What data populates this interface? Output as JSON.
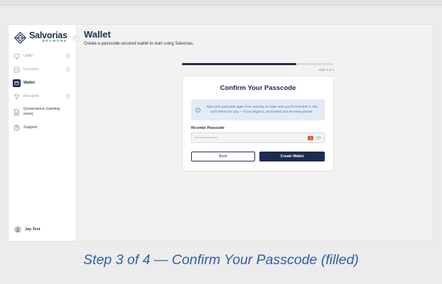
{
  "app": {
    "name": "Salvorias",
    "subtitle": "NETWORK"
  },
  "sidebar": {
    "items": [
      {
        "label": "Utility",
        "icon": "utility-icon",
        "locked": true
      },
      {
        "label": "Licenses",
        "icon": "license-icon",
        "locked": true
      },
      {
        "label": "Wallet",
        "icon": "wallet-icon",
        "active": true
      },
      {
        "label": "Rewards",
        "icon": "trophy-icon",
        "locked": true
      },
      {
        "label": "Governance (coming soon)",
        "icon": "document-icon"
      },
      {
        "label": "Support",
        "icon": "help-icon"
      }
    ],
    "user": {
      "name": "Jay Test"
    }
  },
  "header": {
    "title": "Wallet",
    "subtitle": "Create a passcode-secured wallet to start using Salvorias."
  },
  "progress": {
    "step_text": "Step 3 of 4",
    "fraction": 0.75
  },
  "card": {
    "title": "Confirm Your Passcode",
    "info": "Type your passcode again from memory to make sure you'll remember it. We can't reset it for you — if you forget it, you'll need your recovery phrase.",
    "field_label": "Re-enter Passcode",
    "field_value": "••••••••••••••",
    "back_label": "Back",
    "create_label": "Create Wallet"
  },
  "caption": "Step 3 of 4 — Confirm Your Passcode (filled)",
  "colors": {
    "primary": "#1c2b52",
    "accent_green": "#3a9c3a",
    "info_bg": "#e4ebf6",
    "info_text": "#3f6db3",
    "caption": "#2f5fa6"
  }
}
